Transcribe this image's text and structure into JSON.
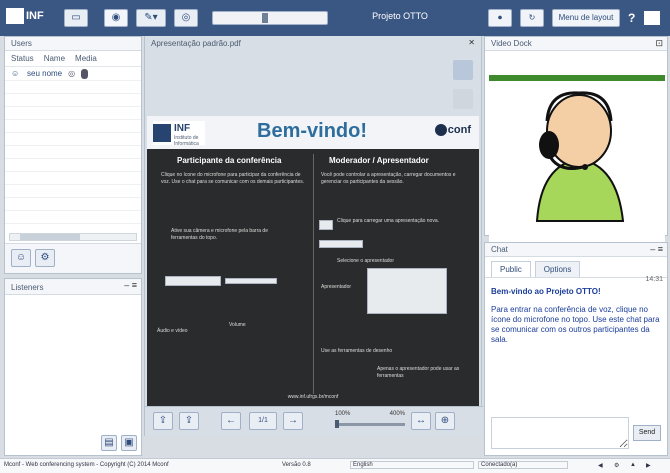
{
  "app": {
    "title": "Projeto OTTO",
    "logo_text": "INF"
  },
  "topbar": {
    "buttons": [
      {
        "name": "monitor-button",
        "glyph": "▭"
      },
      {
        "name": "camera-button",
        "glyph": "◉"
      },
      {
        "name": "mic-dropdown-button",
        "glyph": "✎▾"
      },
      {
        "name": "target-button",
        "glyph": "◎"
      }
    ],
    "volume_level": 0.45,
    "right_buttons": [
      {
        "name": "record-button",
        "label": "⏺"
      },
      {
        "name": "lock-button",
        "label": "↻"
      },
      {
        "name": "layout-dropdown",
        "label": "Menu de layout"
      }
    ],
    "help": "?"
  },
  "users": {
    "title": "Users",
    "columns": [
      "Status",
      "Name",
      "Media"
    ],
    "rows": [
      {
        "status": "☺",
        "name": "seu nome"
      }
    ],
    "footer_buttons": [
      "☺",
      "⚙"
    ]
  },
  "presentation": {
    "title": "Apresentação padrão.pdf",
    "close": "✕",
    "slide": {
      "logo_main": "INF",
      "logo_sub": "Instituto de Informática",
      "welcome": "Bem-vindo!",
      "brand": "conf",
      "left_title": "Participante da conferência",
      "right_title": "Moderador / Apresentador",
      "left_text": "Clique no ícone do microfone para participar da conferência de voz. Use o chat para se comunicar com os demais participantes.",
      "right_text": "Você pode controlar a apresentação, carregar documentos e gerenciar os participantes da sessão.",
      "left_note_1": "Ative sua câmera e microfone pela barra de ferramentas do topo.",
      "left_label_a": "Áudio e vídeo",
      "left_label_b": "Volume",
      "right_note_1": "Clique para carregar uma apresentação nova.",
      "right_note_2": "Selecione o apresentador",
      "right_note_3": "Apresentador",
      "right_note_4": "Use as ferramentas de desenho",
      "right_note_5": "Apenas o apresentador pode usar as ferramentas",
      "footer": "www.inf.ufrgs.br/mconf"
    },
    "controls": {
      "upload": "⇪",
      "prev": "←",
      "page": "1/1",
      "next": "→",
      "zoom_label_left": "100%",
      "zoom_label_right": "400%",
      "zoom_level": 0.0,
      "fit_width": "↔",
      "fit_page": "⊕"
    }
  },
  "listeners": {
    "title": "Listeners",
    "controls": "‒ ≡",
    "footer_buttons": [
      "▤",
      "▣"
    ]
  },
  "webcam": {
    "title": "Video Dock",
    "controls": "⊡"
  },
  "chat": {
    "title": "Chat",
    "controls": "‒ ≡",
    "tabs": [
      "Public",
      "Options"
    ],
    "timestamp": "14:31",
    "welcome_msg": "Bem-vindo ao Projeto OTTO!",
    "message": "Para entrar na conferência de voz, clique no ícone do microfone no topo. Use este chat para se comunicar com os outros participantes da sala.",
    "send": "Send"
  },
  "statusbar": {
    "left_text": "Mconf - Web conferencing system - Copyright (C) 2014 Mconf",
    "mid_text": "Versão 0.8",
    "lang": "English",
    "connection": "Conectado(a)",
    "icons": [
      "◀",
      "⚙",
      "▲",
      "▶"
    ]
  },
  "colors": {
    "topbar": "#3a5683",
    "chat_text": "#1b3d9a",
    "webcam_green": "#3f8a2c"
  }
}
